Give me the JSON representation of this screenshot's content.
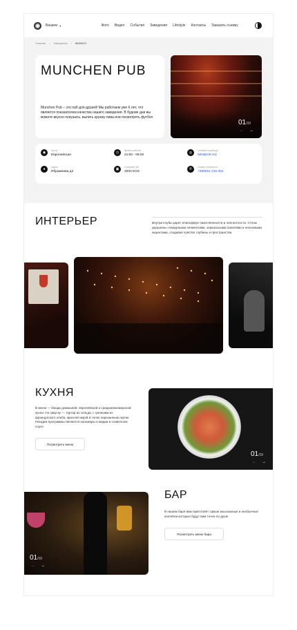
{
  "header": {
    "city": "Бишкек",
    "nav": [
      "Фото",
      "Видео",
      "События",
      "Заведения",
      "Lifestyle",
      "Контакты",
      "Заказать съемку"
    ]
  },
  "breadcrumbs": [
    "Главная",
    "Заведения",
    "MUNICH"
  ],
  "hero": {
    "title": "MUNCHEN PUB",
    "description": "Munchen Pub – это паб для друзей! Мы работаем уже 6 лет, что является показателем качества нашего заведения. В будние дни вы можете вкусно покушать, выпить кружку пива или посмотреть футбол",
    "counter_current": "01",
    "counter_total": "/08"
  },
  "facts": [
    {
      "icon": "cuisine-icon",
      "label": "Кухня",
      "value": "Европейская"
    },
    {
      "icon": "clock-icon",
      "label": "Время работы",
      "value": "21:00 - 06:00"
    },
    {
      "icon": "instagram-icon",
      "label": "Онлайн-страница",
      "value": "MINIBAR.KG",
      "link": true
    },
    {
      "icon": "location-icon",
      "label": "Адрес",
      "value": "Ибраимова д2"
    },
    {
      "icon": "wallet-icon",
      "label": "Средний чек",
      "value": "2000 KGS"
    },
    {
      "icon": "phone-icon",
      "label": "Номер телефона",
      "value": "+996551 015 052",
      "link": true
    }
  ],
  "interior": {
    "title": "ИНТЕРЬЕР",
    "text": "Внутри клуба царит атмосфера таинственности и элегантности. Стены украшены гламурными элементами, зеркальными панелями и неоновыми акцентами, создавая чувство глубины и пространства"
  },
  "kitchen": {
    "title": "КУХНЯ",
    "text": "В меню — блюда домашней, европейской и средиземноморской кухни. На закуску — тартар из сельди, с гренками из французского хлеба, красной икрой и тонко нарезанным луком. Гвоздем программы являются кальмары и мидии в сливочном соусе",
    "button": "Посмотреть меню",
    "counter_current": "01",
    "counter_total": "/08"
  },
  "bar": {
    "title": "БАР",
    "text": "В нашем баре вам приготовят самые изысканные и необычные коктейли которые будут вам точно по душе",
    "button": "Посмотреть меню бара",
    "counter_current": "01",
    "counter_total": "/08"
  },
  "colors": {
    "link": "#2b57d8",
    "hero_bg": "#f3f3f3",
    "dark": "#111111"
  }
}
